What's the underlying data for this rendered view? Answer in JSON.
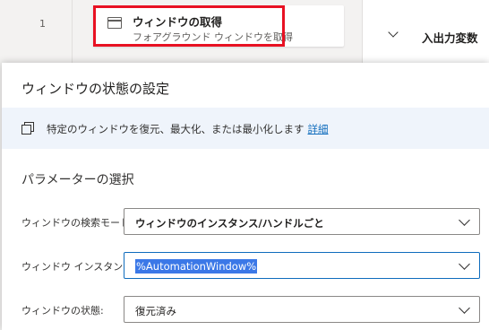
{
  "flow": {
    "line_number": "1",
    "action": {
      "title": "ウィンドウの取得",
      "subtitle": "フォアグラウンド ウィンドウを取得",
      "icon": "window-icon"
    },
    "variables_panel": {
      "title": "入出力変数",
      "icon": "chevron-down-icon"
    }
  },
  "dialog": {
    "title": "ウィンドウの状態の設定",
    "info": {
      "icon": "restore-window-icon",
      "text": "特定のウィンドウを復元、最大化、または最小化します",
      "link": "詳細"
    },
    "section_title": "パラメーターの選択",
    "fields": [
      {
        "label": "ウィンドウの検索モード:",
        "value": "ウィンドウのインスタンス/ハンドルごと"
      },
      {
        "label": "ウィンドウ インスタンス:",
        "value": "%AutomationWindow%"
      },
      {
        "label": "ウィンドウの状態:",
        "value": "復元済み"
      }
    ]
  },
  "colors": {
    "highlight": "#e81123",
    "link": "#0f6cbd",
    "info_bar": "#eff4fb",
    "selection": "#3b78e7"
  }
}
